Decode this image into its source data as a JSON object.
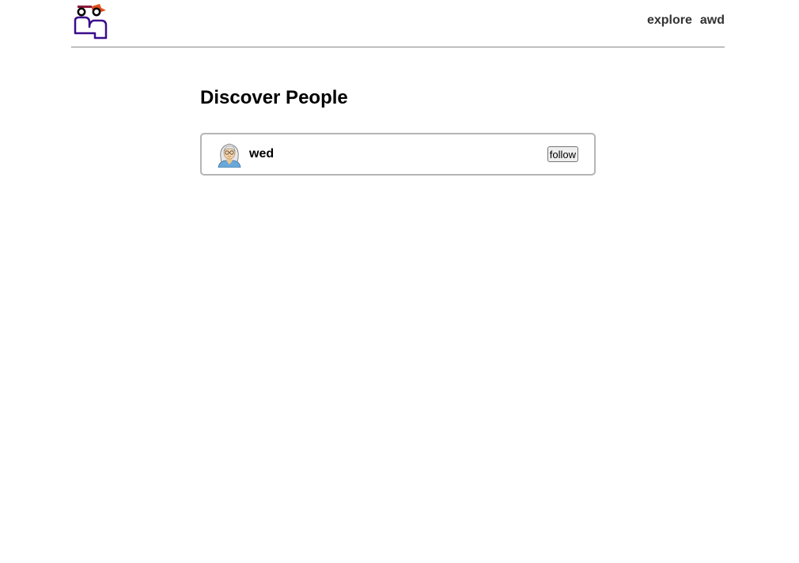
{
  "header": {
    "logo_icon": "people-logo-icon",
    "nav": [
      {
        "label": "explore"
      },
      {
        "label": "awd"
      }
    ]
  },
  "main": {
    "title": "Discover People",
    "people": [
      {
        "name": "wed",
        "avatar_icon": "elderly-woman-avatar-icon",
        "follow_label": "follow"
      }
    ]
  },
  "colors": {
    "logo_primary": "#3b0d8c",
    "logo_accent": "#e0501a",
    "card_border": "#b5b5b5",
    "header_rule": "#8a8a8a"
  }
}
